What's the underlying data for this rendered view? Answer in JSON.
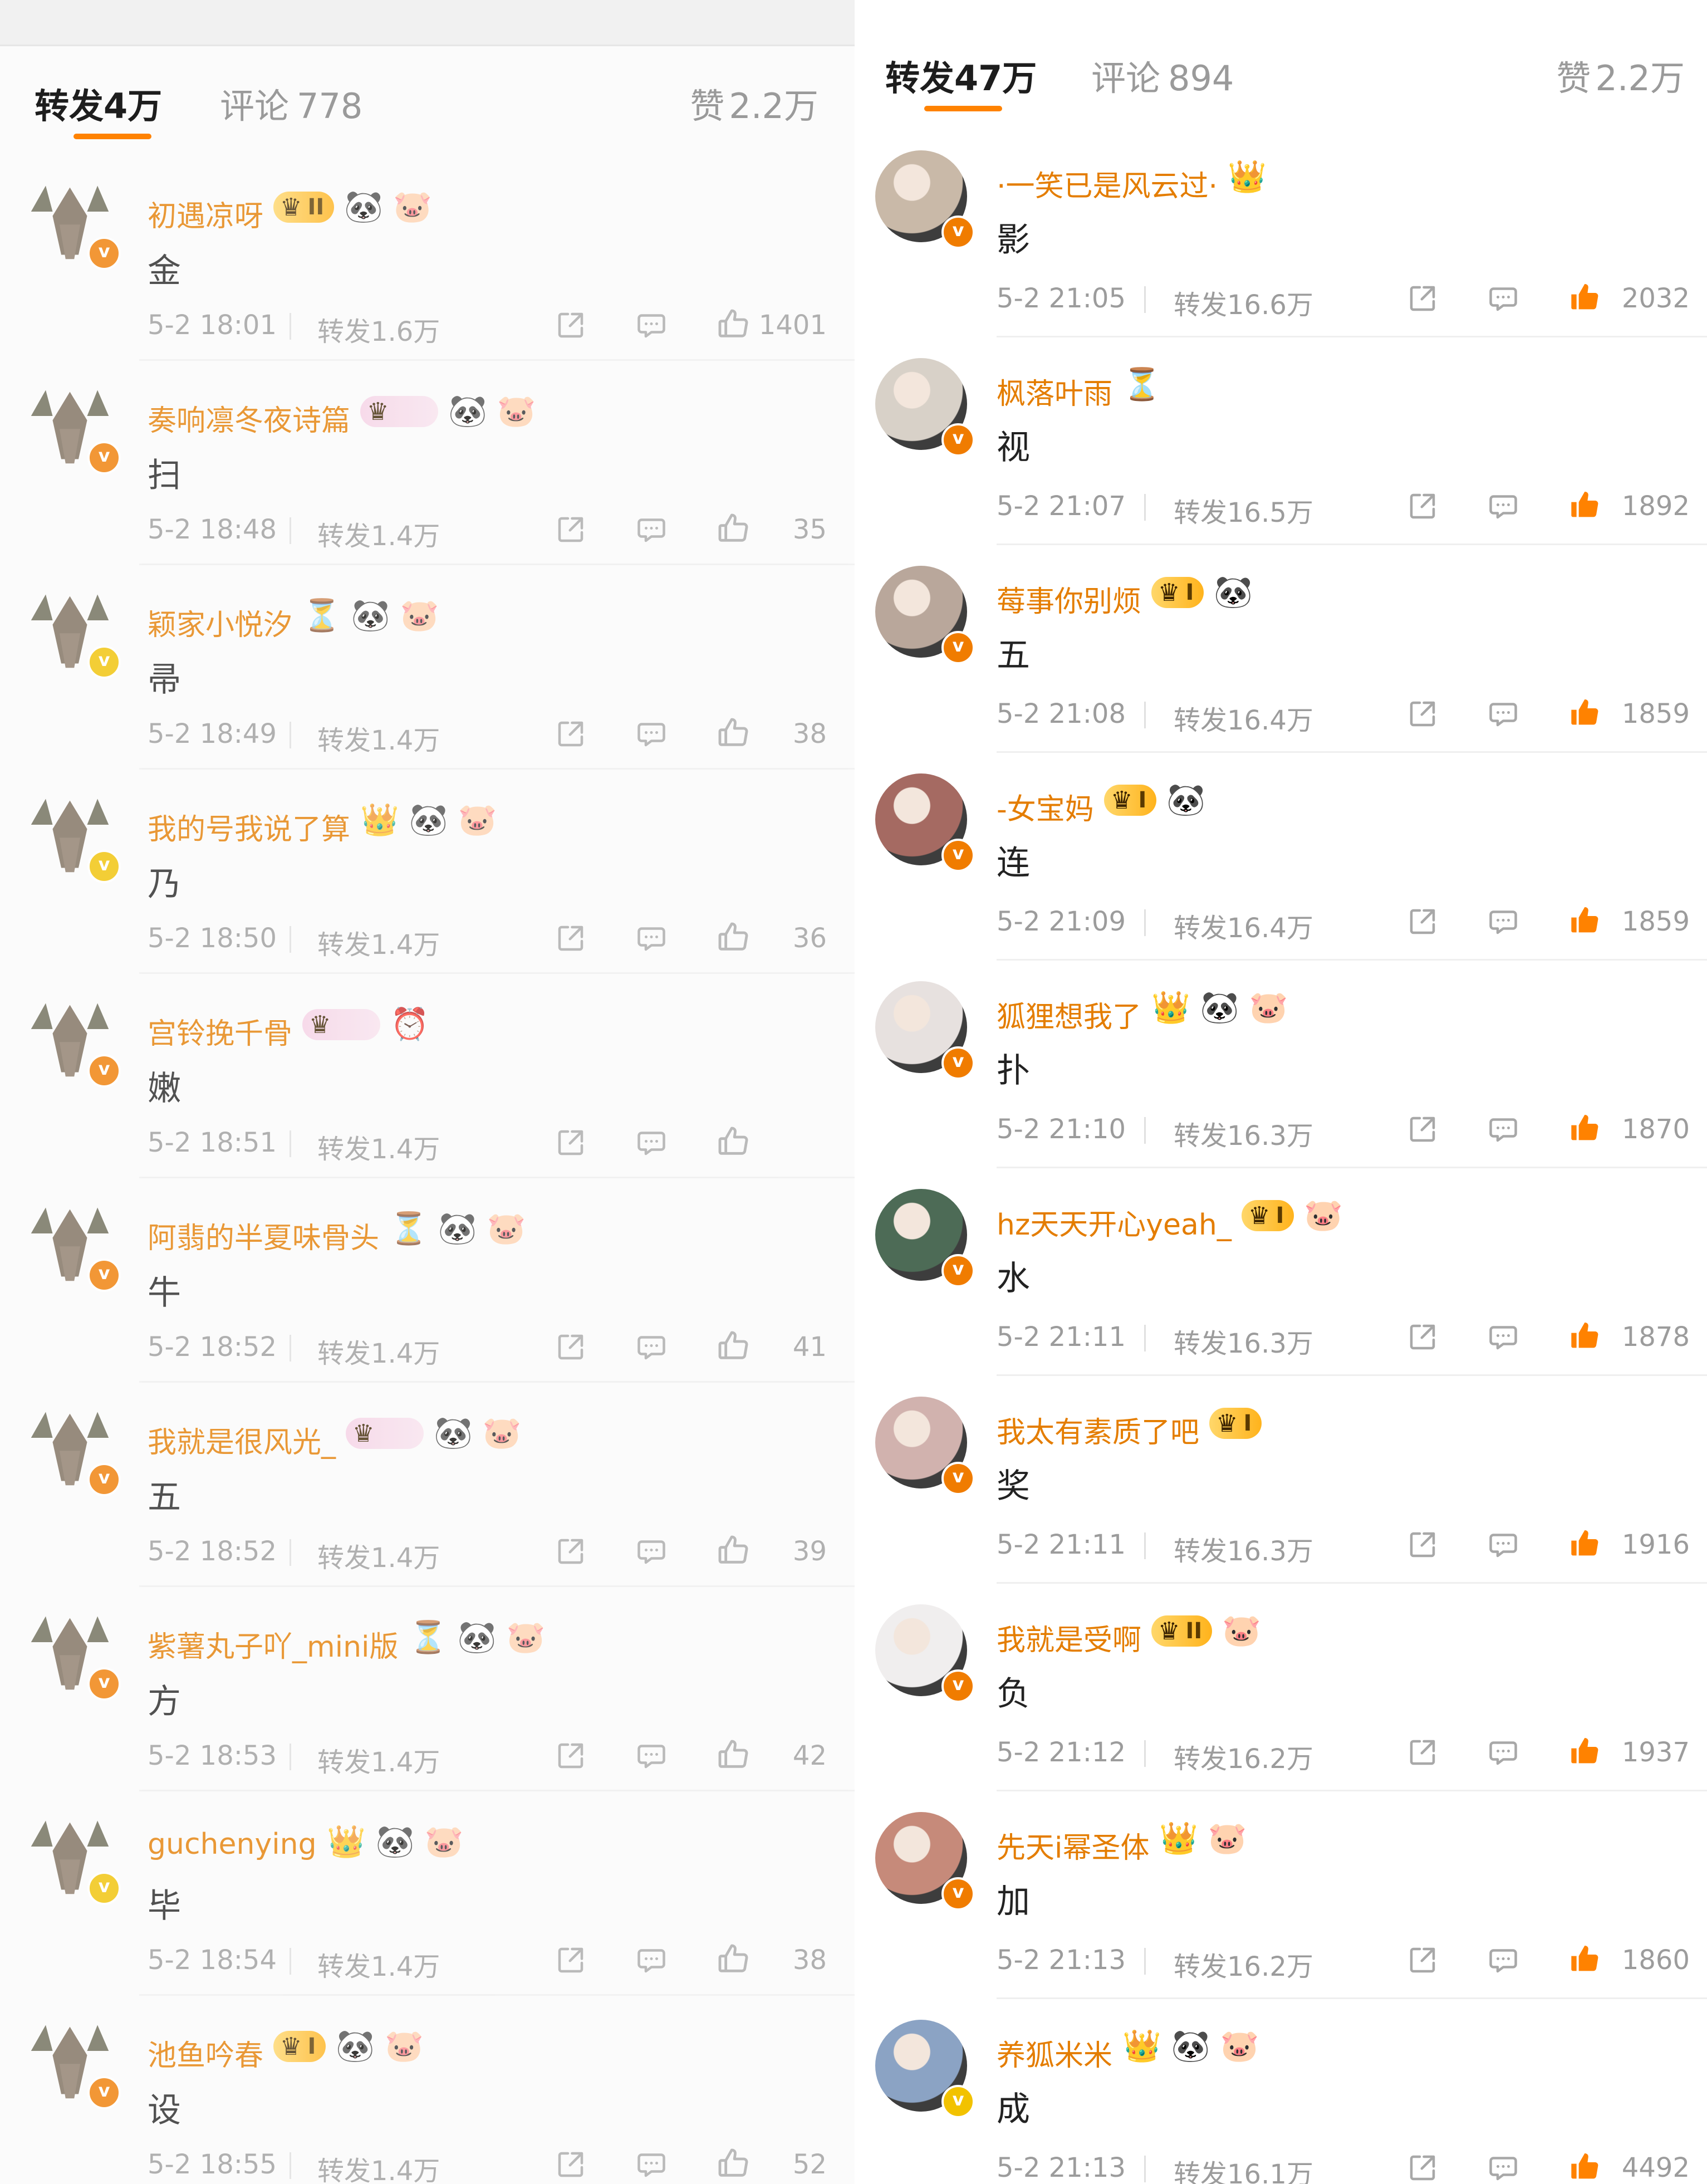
{
  "left": {
    "tabs": {
      "reposts_label": "转发",
      "reposts_count": "4万",
      "comments_label": "评论",
      "comments_count": "778",
      "likes_label": "赞",
      "likes_count": "2.2万"
    },
    "comments": [
      {
        "username": "初遇凉呀",
        "badges": [
          "member-crown-II",
          "panda-icon",
          "pig-icon"
        ],
        "content": "金",
        "time": "5-2 18:01",
        "reposts": "转发1.6万",
        "likes": "1401",
        "liked": false
      },
      {
        "username": "奏响凛冬夜诗篇",
        "badges": [
          "member-tag",
          "panda-icon",
          "pig-icon"
        ],
        "content": "扫",
        "time": "5-2 18:48",
        "reposts": "转发1.4万",
        "likes": "35",
        "liked": false
      },
      {
        "username": "颖家小悦汐",
        "badges": [
          "hourglass-icon",
          "panda-icon",
          "pig-icon"
        ],
        "content": "帚",
        "time": "5-2 18:49",
        "reposts": "转发1.4万",
        "likes": "38",
        "liked": false
      },
      {
        "username": "我的号我说了算",
        "badges": [
          "crown-icon",
          "panda-icon",
          "pig-icon"
        ],
        "content": "乃",
        "time": "5-2 18:50",
        "reposts": "转发1.4万",
        "likes": "36",
        "liked": false
      },
      {
        "username": "宫铃挽千骨",
        "badges": [
          "member-tag",
          "alarm-icon"
        ],
        "content": "嫩",
        "time": "5-2 18:51",
        "reposts": "转发1.4万",
        "likes": "",
        "liked": false
      },
      {
        "username": "阿翡的半夏味骨头",
        "badges": [
          "hourglass-icon",
          "panda-icon",
          "pig-icon"
        ],
        "content": "牛",
        "time": "5-2 18:52",
        "reposts": "转发1.4万",
        "likes": "41",
        "liked": false
      },
      {
        "username": "我就是很风光_",
        "badges": [
          "member-tag",
          "panda-icon",
          "pig-icon"
        ],
        "content": "五",
        "time": "5-2 18:52",
        "reposts": "转发1.4万",
        "likes": "39",
        "liked": false
      },
      {
        "username": "紫薯丸子吖_mini版",
        "badges": [
          "hourglass-icon",
          "panda-icon",
          "pig-icon"
        ],
        "content": "方",
        "time": "5-2 18:53",
        "reposts": "转发1.4万",
        "likes": "42",
        "liked": false
      },
      {
        "username": "guchenying",
        "badges": [
          "crown-icon",
          "panda-icon",
          "pig-icon"
        ],
        "content": "毕",
        "time": "5-2 18:54",
        "reposts": "转发1.4万",
        "likes": "38",
        "liked": false
      },
      {
        "username": "池鱼吟春",
        "badges": [
          "member-crown-I",
          "panda-icon",
          "pig-icon"
        ],
        "content": "设",
        "time": "5-2 18:55",
        "reposts": "转发1.4万",
        "likes": "52",
        "liked": false
      }
    ]
  },
  "right": {
    "tabs": {
      "reposts_label": "转发",
      "reposts_count": "47万",
      "comments_label": "评论",
      "comments_count": "894",
      "likes_label": "赞",
      "likes_count": "2.2万"
    },
    "comments": [
      {
        "username": "·一笑已是风云过·",
        "badges": [
          "crown-icon"
        ],
        "content": "影",
        "time": "5-2 21:05",
        "reposts": "转发16.6万",
        "likes": "2032",
        "liked": true
      },
      {
        "username": "枫落叶雨",
        "badges": [
          "hourglass-icon"
        ],
        "content": "视",
        "time": "5-2 21:07",
        "reposts": "转发16.5万",
        "likes": "1892",
        "liked": true
      },
      {
        "username": "莓事你别烦",
        "badges": [
          "member-crown-I",
          "panda-icon"
        ],
        "content": "五",
        "time": "5-2 21:08",
        "reposts": "转发16.4万",
        "likes": "1859",
        "liked": true
      },
      {
        "username": "-女宝妈",
        "badges": [
          "member-crown-I",
          "panda-icon"
        ],
        "content": "连",
        "time": "5-2 21:09",
        "reposts": "转发16.4万",
        "likes": "1859",
        "liked": true
      },
      {
        "username": "狐狸想我了",
        "badges": [
          "crown-icon",
          "panda-icon",
          "pig-icon"
        ],
        "content": "扑",
        "time": "5-2 21:10",
        "reposts": "转发16.3万",
        "likes": "1870",
        "liked": true
      },
      {
        "username": "hz天天开心yeah_",
        "badges": [
          "member-crown-I",
          "pig-icon"
        ],
        "content": "水",
        "time": "5-2 21:11",
        "reposts": "转发16.3万",
        "likes": "1878",
        "liked": true
      },
      {
        "username": "我太有素质了吧",
        "badges": [
          "member-crown-I"
        ],
        "content": "奖",
        "time": "5-2 21:11",
        "reposts": "转发16.3万",
        "likes": "1916",
        "liked": true
      },
      {
        "username": "我就是受啊",
        "badges": [
          "member-tag-II",
          "pig-icon"
        ],
        "content": "负",
        "time": "5-2 21:12",
        "reposts": "转发16.2万",
        "likes": "1937",
        "liked": true
      },
      {
        "username": "先天i幂圣体",
        "badges": [
          "crown-icon",
          "pig-icon"
        ],
        "content": "加",
        "time": "5-2 21:13",
        "reposts": "转发16.2万",
        "likes": "1860",
        "liked": true
      },
      {
        "username": "养狐米米",
        "badges": [
          "crown-icon",
          "panda-icon",
          "pig-icon"
        ],
        "content": "成",
        "time": "5-2 21:13",
        "reposts": "转发16.1万",
        "likes": "4492",
        "liked": true
      }
    ]
  },
  "colors": {
    "accent": "#ff8200",
    "username": "#e47d00",
    "meta": "#9c9c9c",
    "verified_orange": "#f07c00",
    "verified_gold": "#f2c200"
  }
}
